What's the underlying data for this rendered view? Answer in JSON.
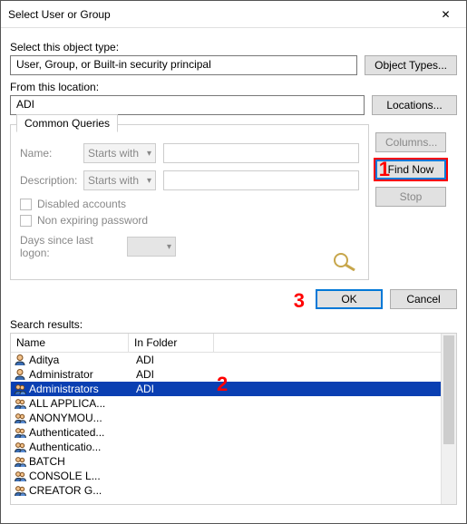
{
  "window": {
    "title": "Select User or Group"
  },
  "section": {
    "object_type_label": "Select this object type:",
    "object_type_value": "User, Group, or Built-in security principal",
    "object_types_btn": "Object Types...",
    "location_label": "From this location:",
    "location_value": "ADI",
    "locations_btn": "Locations..."
  },
  "queries": {
    "tab": "Common Queries",
    "name_label": "Name:",
    "name_mode": "Starts with",
    "desc_label": "Description:",
    "desc_mode": "Starts with",
    "disabled_chk": "Disabled accounts",
    "nonexp_chk": "Non expiring password",
    "days_label": "Days since last logon:",
    "columns_btn": "Columns...",
    "findnow_btn": "Find Now",
    "stop_btn": "Stop"
  },
  "actions": {
    "ok": "OK",
    "cancel": "Cancel"
  },
  "results": {
    "label": "Search results:",
    "col_name": "Name",
    "col_folder": "In Folder",
    "items": [
      {
        "type": "user",
        "name": "Aditya",
        "folder": "ADI",
        "selected": false
      },
      {
        "type": "user",
        "name": "Administrator",
        "folder": "ADI",
        "selected": false
      },
      {
        "type": "group",
        "name": "Administrators",
        "folder": "ADI",
        "selected": true
      },
      {
        "type": "group",
        "name": "ALL APPLICA...",
        "folder": "",
        "selected": false
      },
      {
        "type": "group",
        "name": "ANONYMOU...",
        "folder": "",
        "selected": false
      },
      {
        "type": "group",
        "name": "Authenticated...",
        "folder": "",
        "selected": false
      },
      {
        "type": "group",
        "name": "Authenticatio...",
        "folder": "",
        "selected": false
      },
      {
        "type": "group",
        "name": "BATCH",
        "folder": "",
        "selected": false
      },
      {
        "type": "group",
        "name": "CONSOLE L...",
        "folder": "",
        "selected": false
      },
      {
        "type": "group",
        "name": "CREATOR G...",
        "folder": "",
        "selected": false
      }
    ]
  },
  "annotations": {
    "a1": "1",
    "a2": "2",
    "a3": "3"
  }
}
